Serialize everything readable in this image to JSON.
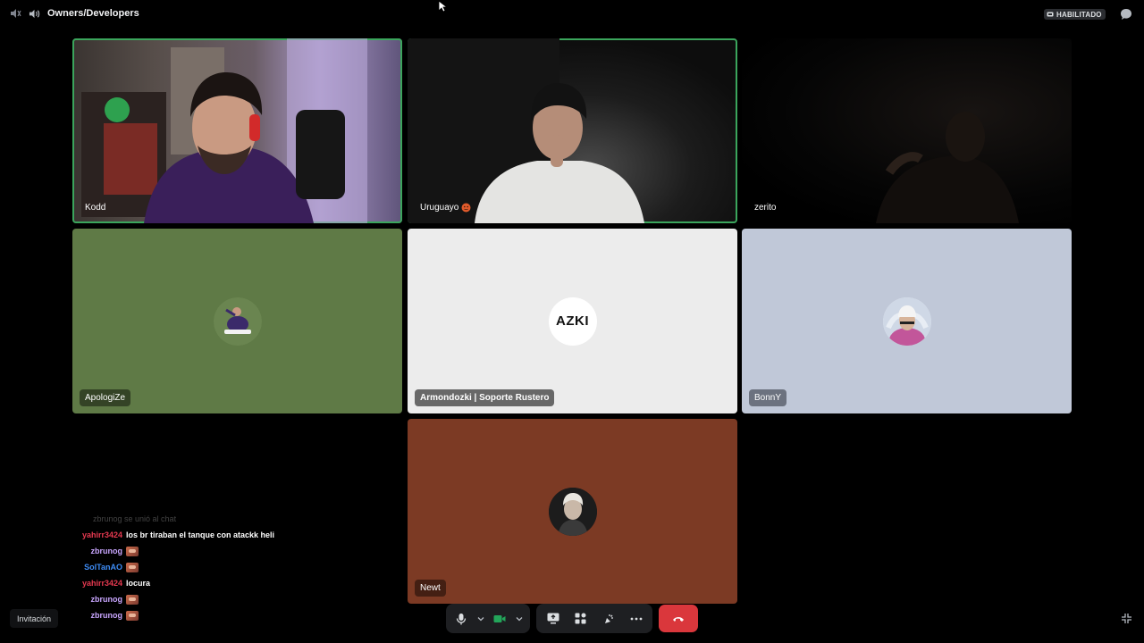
{
  "header": {
    "channel_name": "Owners/Developers",
    "badge_label": "HABILITADO"
  },
  "tiles": [
    {
      "name": "Kodd",
      "speaking": true,
      "type": "video"
    },
    {
      "name": "Uruguayo",
      "speaking": true,
      "type": "video"
    },
    {
      "name": "zerito",
      "speaking": false,
      "type": "video"
    },
    {
      "name": "ApologiZe",
      "speaking": false,
      "type": "avatar",
      "bg": "#5f7a46"
    },
    {
      "name": "Armondozki | Soporte Rustero",
      "speaking": false,
      "type": "avatar",
      "bg": "#ececec",
      "avatar_text": "AZKI"
    },
    {
      "name": "BonnY",
      "speaking": false,
      "type": "avatar",
      "bg": "#c0c8d8"
    },
    {
      "name": "Newt",
      "speaking": false,
      "type": "avatar",
      "bg": "#7c3a24"
    }
  ],
  "chat": {
    "faded_line": "zbrunog se unió al chat",
    "messages": [
      {
        "user": "yahirr3424",
        "color": "#e63950",
        "text": "los br tiraban el tanque con atackk heli",
        "emote": false
      },
      {
        "user": "zbrunog",
        "color": "#c9a6ff",
        "text": "",
        "emote": true
      },
      {
        "user": "SolTanAO",
        "color": "#3e8cf5",
        "text": "",
        "emote": true
      },
      {
        "user": "yahirr3424",
        "color": "#e63950",
        "text": "locura",
        "emote": false
      },
      {
        "user": "zbrunog",
        "color": "#c9a6ff",
        "text": "",
        "emote": true
      },
      {
        "user": "zbrunog",
        "color": "#c9a6ff",
        "text": "",
        "emote": true
      }
    ]
  },
  "controls": {
    "invite_label": "Invitación",
    "icons": [
      "microphone-icon",
      "camera-icon",
      "screen-share-icon",
      "activities-icon",
      "soundboard-icon",
      "more-icon",
      "hang-up-icon"
    ]
  },
  "colors": {
    "speaking_outline": "#3ba55c",
    "hangup": "#da373c",
    "control_bg": "#1e1f22"
  }
}
